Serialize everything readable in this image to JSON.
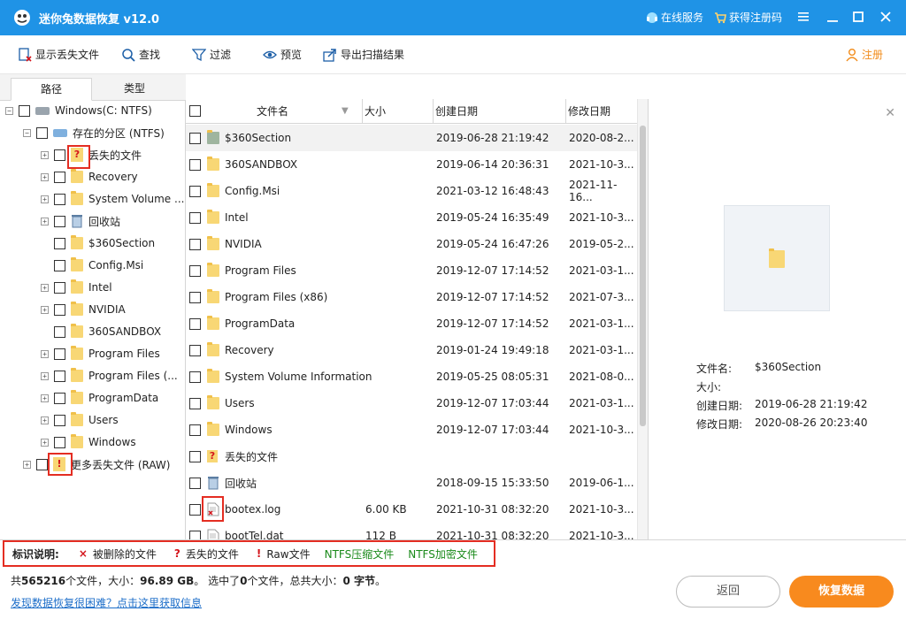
{
  "app": {
    "title": "迷你兔数据恢复 v12.0",
    "online_service": "在线服务",
    "get_code": "获得注册码",
    "accent": "#1f93e6"
  },
  "toolbar": {
    "show_lost": "显示丢失文件",
    "find": "查找",
    "filter": "过滤",
    "preview": "预览",
    "export": "导出扫描结果",
    "register": "注册"
  },
  "tabs": {
    "path": "路径",
    "type": "类型"
  },
  "tree": {
    "root": "Windows(C: NTFS)",
    "partition": "存在的分区 (NTFS)",
    "items": [
      "丢失的文件",
      "Recovery",
      "System Volume ...",
      "回收站",
      "$360Section",
      "Config.Msi",
      "Intel",
      "NVIDIA",
      "360SANDBOX",
      "Program Files",
      "Program Files (...",
      "ProgramData",
      "Users",
      "Windows"
    ],
    "raw": "更多丢失文件 (RAW)"
  },
  "list": {
    "headers": {
      "name": "文件名",
      "size": "大小",
      "created": "创建日期",
      "modified": "修改日期"
    },
    "rows": [
      {
        "name": "$360Section",
        "size": "",
        "created": "2019-06-28 21:19:42",
        "modified": "2020-08-2..."
      },
      {
        "name": "360SANDBOX",
        "size": "",
        "created": "2019-06-14 20:36:31",
        "modified": "2021-10-3..."
      },
      {
        "name": "Config.Msi",
        "size": "",
        "created": "2021-03-12 16:48:43",
        "modified": "2021-11-16..."
      },
      {
        "name": "Intel",
        "size": "",
        "created": "2019-05-24 16:35:49",
        "modified": "2021-10-3..."
      },
      {
        "name": "NVIDIA",
        "size": "",
        "created": "2019-05-24 16:47:26",
        "modified": "2019-05-2..."
      },
      {
        "name": "Program Files",
        "size": "",
        "created": "2019-12-07 17:14:52",
        "modified": "2021-03-1..."
      },
      {
        "name": "Program Files (x86)",
        "size": "",
        "created": "2019-12-07 17:14:52",
        "modified": "2021-07-3..."
      },
      {
        "name": "ProgramData",
        "size": "",
        "created": "2019-12-07 17:14:52",
        "modified": "2021-03-1..."
      },
      {
        "name": "Recovery",
        "size": "",
        "created": "2019-01-24 19:49:18",
        "modified": "2021-03-1..."
      },
      {
        "name": "System Volume Information",
        "size": "",
        "created": "2019-05-25 08:05:31",
        "modified": "2021-08-0..."
      },
      {
        "name": "Users",
        "size": "",
        "created": "2019-12-07 17:03:44",
        "modified": "2021-03-1..."
      },
      {
        "name": "Windows",
        "size": "",
        "created": "2019-12-07 17:03:44",
        "modified": "2021-10-3..."
      },
      {
        "name": "丢失的文件",
        "size": "",
        "created": "",
        "modified": ""
      },
      {
        "name": "回收站",
        "size": "",
        "created": "2018-09-15 15:33:50",
        "modified": "2019-06-1..."
      },
      {
        "name": "bootex.log",
        "size": "6.00 KB",
        "created": "2021-10-31 08:32:20",
        "modified": "2021-10-3..."
      },
      {
        "name": "bootTel.dat",
        "size": "112 B",
        "created": "2021-10-31 08:32:20",
        "modified": "2021-10-3..."
      }
    ]
  },
  "preview": {
    "labels": {
      "name": "文件名:",
      "size": "大小:",
      "created": "创建日期:",
      "modified": "修改日期:"
    },
    "values": {
      "name": "$360Section",
      "size": "",
      "created": "2019-06-28 21:19:42",
      "modified": "2020-08-26 20:23:40"
    }
  },
  "legend": {
    "title": "标识说明:",
    "deleted": "被删除的文件",
    "lost": "丢失的文件",
    "raw": "Raw文件",
    "compressed": "NTFS压缩文件",
    "encrypted": "NTFS加密文件"
  },
  "status": {
    "prefix": "共",
    "total_files": "565216",
    "mid1": "个文件，大小：",
    "total_size": "96.89 GB",
    "mid2": "。 选中了",
    "selected": "0",
    "mid3": "个文件，总共大小：",
    "selected_size": "0 字节",
    "suffix": "。"
  },
  "help": "发现数据恢复很困难？点击这里获取信息",
  "buttons": {
    "back": "返回",
    "recover": "恢复数据"
  }
}
